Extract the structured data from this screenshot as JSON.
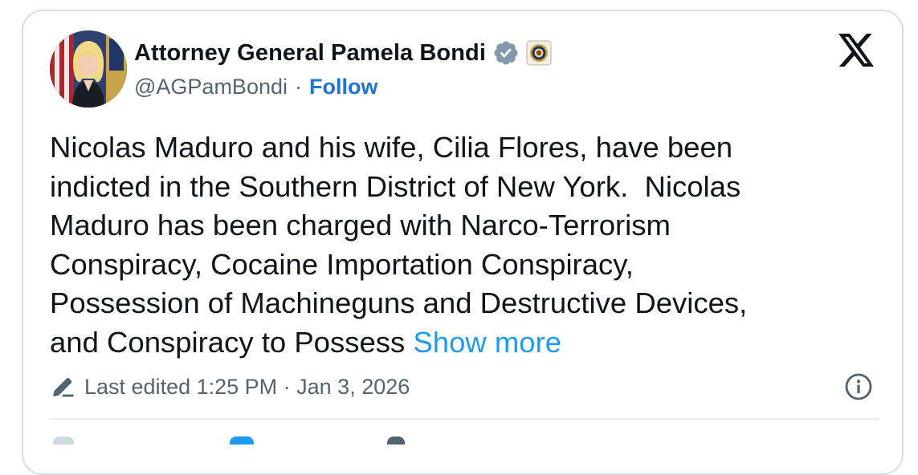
{
  "author": {
    "display_name": "Attorney General Pamela Bondi",
    "handle": "@AGPamBondi",
    "separator": "·",
    "follow_label": "Follow"
  },
  "colors": {
    "verified": "#829aab",
    "follow": "#1d74d6",
    "link": "#1d9bf0",
    "muted": "#536471"
  },
  "icons": {
    "verified": "verified-badge-icon",
    "affiliate": "doj-seal-icon",
    "logo": "x-logo-icon",
    "edit": "pencil-icon",
    "info": "info-icon"
  },
  "tweet": {
    "text": "Nicolas Maduro and his wife, Cilia Flores, have been\nindicted in the Southern District of New York.  Nicolas\nMaduro has been charged with Narco-Terrorism\nConspiracy, Cocaine Importation Conspiracy,\nPossession of Machineguns and Destructive Devices,\nand Conspiracy to Possess ",
    "show_more_label": "Show more"
  },
  "meta": {
    "edited_text": "Last edited 1:25 PM · Jan 3, 2026"
  }
}
